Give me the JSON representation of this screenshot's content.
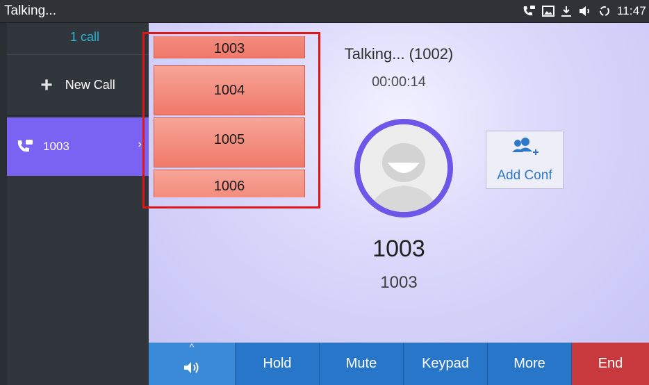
{
  "status_bar": {
    "title": "Talking...",
    "time": "11:47",
    "icons": [
      "voicemail-call-icon",
      "image-icon",
      "download-icon",
      "speaker-icon",
      "sync-icon"
    ]
  },
  "sidebar": {
    "call_count": "1 call",
    "new_call_label": "New Call",
    "active_call": {
      "label": "1003",
      "icon": "phone-call-icon",
      "arrow": "›"
    }
  },
  "main": {
    "status": "Talking... (1002)",
    "timer": "00:00:14",
    "contact_name": "1003",
    "contact_number": "1003",
    "add_conf_label": "Add Conf"
  },
  "dial_list": {
    "items": [
      "1003",
      "1004",
      "1005",
      "1006"
    ]
  },
  "bottom_bar": {
    "speaker_icon": "speaker-icon",
    "hold": "Hold",
    "mute": "Mute",
    "keypad": "Keypad",
    "more": "More",
    "end": "End",
    "caret": "^"
  },
  "colors": {
    "accent_purple": "#7a63f2",
    "ring_purple": "#6d56e8",
    "bar_blue": "#2876c9",
    "end_red": "#c8393d",
    "list_red": "#f0796a",
    "highlight_red": "#e01616",
    "cyan_text": "#2ab5d6"
  }
}
